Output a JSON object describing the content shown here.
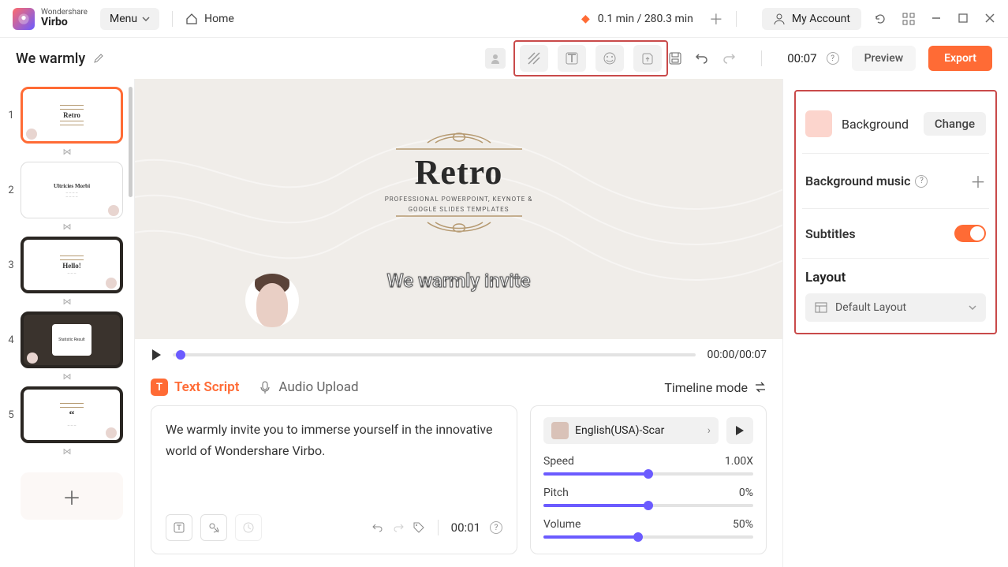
{
  "brand": {
    "ws": "Wondershare",
    "name": "Virbo"
  },
  "titlebar": {
    "menu": "Menu",
    "home": "Home",
    "usage": "0.1 min / 280.3 min",
    "account": "My Account"
  },
  "project": {
    "name": "We warmly"
  },
  "toolbar": {
    "time": "00:07",
    "preview": "Preview",
    "export": "Export"
  },
  "slides": [
    {
      "num": "1",
      "title": "Retro",
      "active": true,
      "avatar": "left",
      "style": "light"
    },
    {
      "num": "2",
      "title": "Ultricies Morbi",
      "active": false,
      "avatar": "right",
      "style": "light"
    },
    {
      "num": "3",
      "title": "Hello!",
      "active": false,
      "avatar": "right",
      "style": "framed"
    },
    {
      "num": "4",
      "title": "Statistic Result",
      "active": false,
      "avatar": "left",
      "style": "dark"
    },
    {
      "num": "5",
      "title": "“",
      "active": false,
      "avatar": "right",
      "style": "framed"
    }
  ],
  "canvas": {
    "title": "Retro",
    "subtitle1": "PROFESSIONAL POWERPOINT, KEYNOTE &",
    "subtitle2": "GOOGLE SLIDES TEMPLATES",
    "caption": "We warmly invite"
  },
  "playback": {
    "time": "00:00/00:07"
  },
  "script": {
    "tab_text": "Text Script",
    "tab_audio": "Audio Upload",
    "timeline": "Timeline mode",
    "content": "We warmly invite you to immerse yourself in the innovative world of Wondershare Virbo.",
    "time": "00:01"
  },
  "voice": {
    "name": "English(USA)-Scar",
    "speed_label": "Speed",
    "speed_val": "1.00X",
    "speed_pct": 50,
    "pitch_label": "Pitch",
    "pitch_val": "0%",
    "pitch_pct": 50,
    "volume_label": "Volume",
    "volume_val": "50%",
    "volume_pct": 45
  },
  "props": {
    "background": "Background",
    "change": "Change",
    "bgmusic": "Background music",
    "subtitles": "Subtitles",
    "layout": "Layout",
    "layout_val": "Default Layout"
  }
}
